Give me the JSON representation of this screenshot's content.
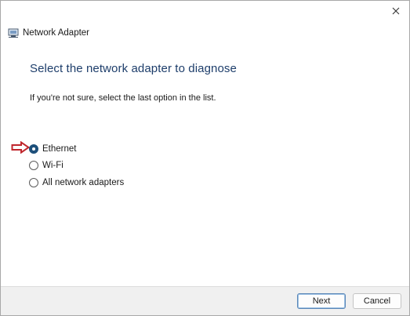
{
  "window": {
    "title": "Network Adapter",
    "close_glyph": "✕"
  },
  "content": {
    "heading": "Select the network adapter to diagnose",
    "hint": "If you're not sure, select the last option in the list."
  },
  "options": [
    {
      "label": "Ethernet",
      "selected": true
    },
    {
      "label": "Wi-Fi",
      "selected": false
    },
    {
      "label": "All network adapters",
      "selected": false
    }
  ],
  "footer": {
    "next_label": "Next",
    "cancel_label": "Cancel"
  },
  "colors": {
    "heading": "#1e3e6b",
    "annotation_arrow": "#c0272d",
    "selected_radio": "#1d4f7a"
  },
  "icons": {
    "title_icon": "network-adapter-icon",
    "close_icon": "close-icon",
    "annotation": "red-arrow-icon"
  }
}
